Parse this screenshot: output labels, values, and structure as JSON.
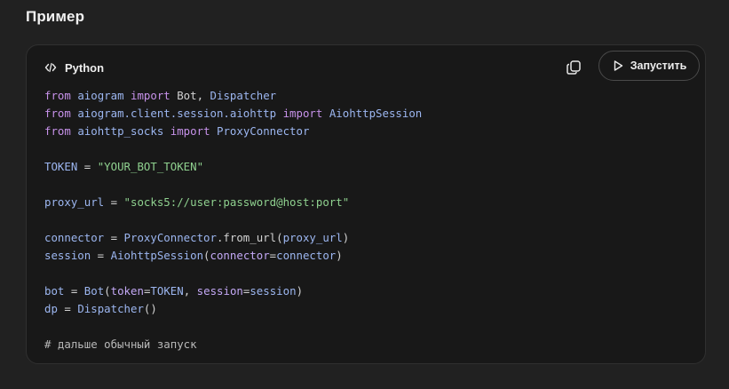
{
  "section": {
    "title": "Пример"
  },
  "code_block": {
    "language": "Python",
    "copy_icon": "copy-icon",
    "language_icon": "code-icon",
    "run_icon": "play-icon",
    "run_label": "Запустить",
    "colors": {
      "keyword": "#c792ea",
      "module": "#9cb6f0",
      "string": "#8fd18f",
      "param": "#c3a8f5",
      "comment": "#b9b9b9"
    },
    "lines": [
      [
        {
          "t": "from",
          "c": "kw"
        },
        {
          "t": " "
        },
        {
          "t": "aiogram",
          "c": "mod"
        },
        {
          "t": " "
        },
        {
          "t": "import",
          "c": "kw"
        },
        {
          "t": " Bot, "
        },
        {
          "t": "Dispatcher",
          "c": "mod"
        }
      ],
      [
        {
          "t": "from",
          "c": "kw"
        },
        {
          "t": " "
        },
        {
          "t": "aiogram.client.session.aiohttp",
          "c": "mod"
        },
        {
          "t": " "
        },
        {
          "t": "import",
          "c": "kw"
        },
        {
          "t": " "
        },
        {
          "t": "AiohttpSession",
          "c": "mod"
        }
      ],
      [
        {
          "t": "from",
          "c": "kw"
        },
        {
          "t": " "
        },
        {
          "t": "aiohttp_socks",
          "c": "mod"
        },
        {
          "t": " "
        },
        {
          "t": "import",
          "c": "kw"
        },
        {
          "t": " "
        },
        {
          "t": "ProxyConnector",
          "c": "mod"
        }
      ],
      [],
      [
        {
          "t": "TOKEN",
          "c": "mod"
        },
        {
          "t": " = "
        },
        {
          "t": "\"YOUR_BOT_TOKEN\"",
          "c": "str"
        }
      ],
      [],
      [
        {
          "t": "proxy_url",
          "c": "mod"
        },
        {
          "t": " = "
        },
        {
          "t": "\"socks5://user:password@host:port\"",
          "c": "str"
        }
      ],
      [],
      [
        {
          "t": "connector",
          "c": "mod"
        },
        {
          "t": " = "
        },
        {
          "t": "ProxyConnector",
          "c": "mod"
        },
        {
          "t": ".from_url("
        },
        {
          "t": "proxy_url",
          "c": "mod"
        },
        {
          "t": ")"
        }
      ],
      [
        {
          "t": "session",
          "c": "mod"
        },
        {
          "t": " = "
        },
        {
          "t": "AiohttpSession",
          "c": "mod"
        },
        {
          "t": "("
        },
        {
          "t": "connector",
          "c": "param"
        },
        {
          "t": "="
        },
        {
          "t": "connector",
          "c": "mod"
        },
        {
          "t": ")"
        }
      ],
      [],
      [
        {
          "t": "bot",
          "c": "mod"
        },
        {
          "t": " = "
        },
        {
          "t": "Bot",
          "c": "mod"
        },
        {
          "t": "("
        },
        {
          "t": "token",
          "c": "param"
        },
        {
          "t": "="
        },
        {
          "t": "TOKEN",
          "c": "mod"
        },
        {
          "t": ", "
        },
        {
          "t": "session",
          "c": "param"
        },
        {
          "t": "="
        },
        {
          "t": "session",
          "c": "mod"
        },
        {
          "t": ")"
        }
      ],
      [
        {
          "t": "dp",
          "c": "mod"
        },
        {
          "t": " = "
        },
        {
          "t": "Dispatcher",
          "c": "mod"
        },
        {
          "t": "()"
        }
      ],
      [],
      [
        {
          "t": "# дальше обычный запуск",
          "c": "cm"
        }
      ]
    ]
  }
}
